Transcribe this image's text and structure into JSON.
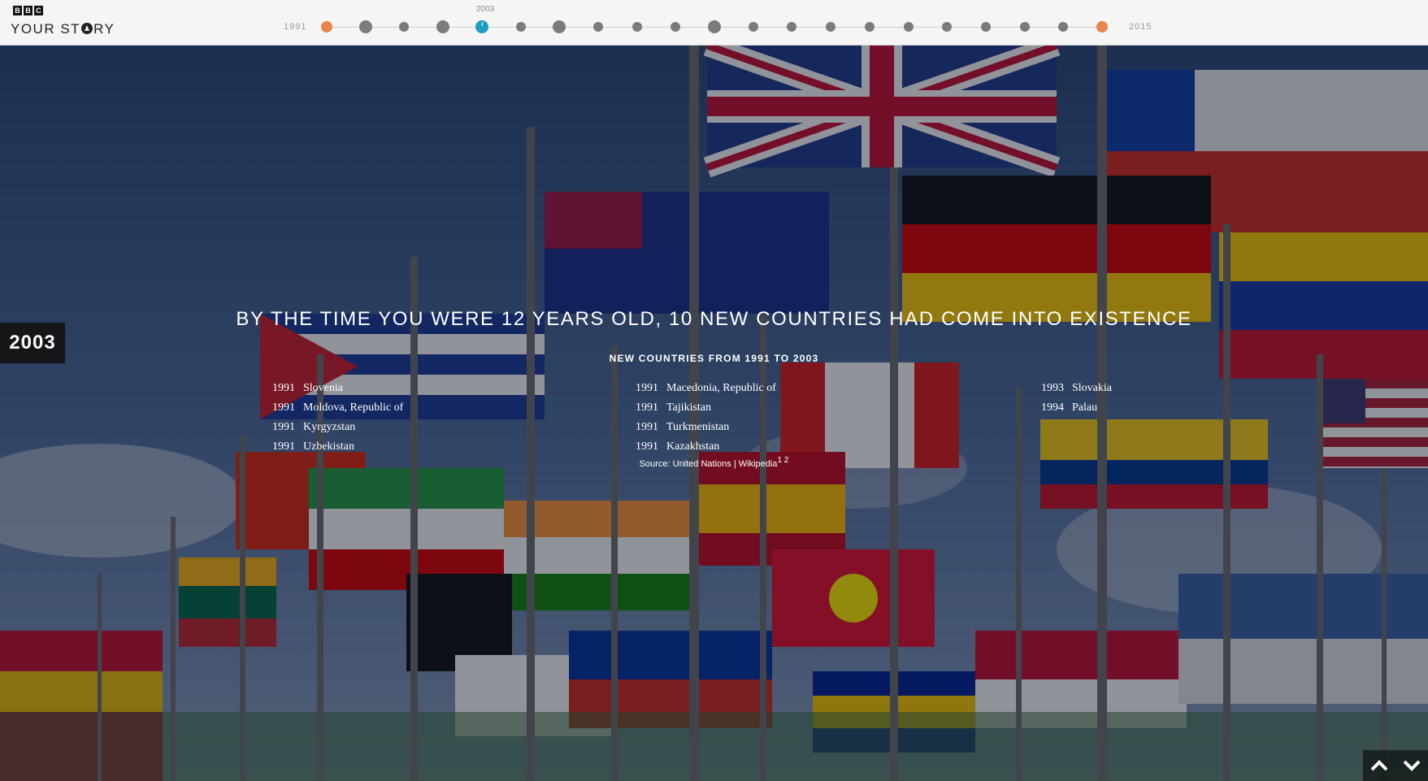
{
  "header": {
    "logo_letters": [
      "B",
      "B",
      "C"
    ],
    "brand_left": "YOUR ST",
    "brand_right": "RY"
  },
  "timeline": {
    "start_year": "1991",
    "end_year": "2015",
    "current_year_label": "2003",
    "colors": {
      "endpoint": "#e8854a",
      "current": "#1a9fc2",
      "default": "#7b7b7b",
      "line": "#cfcfcf"
    }
  },
  "main": {
    "year_badge": "2003",
    "headline": "BY THE TIME YOU WERE 12 YEARS OLD, 10 NEW COUNTRIES HAD COME INTO EXISTENCE",
    "subheading": "NEW COUNTRIES FROM 1991 TO 2003",
    "columns": [
      [
        {
          "year": "1991",
          "country": "Slovenia"
        },
        {
          "year": "1991",
          "country": "Moldova, Republic of"
        },
        {
          "year": "1991",
          "country": "Kyrgyzstan"
        },
        {
          "year": "1991",
          "country": "Uzbekistan"
        }
      ],
      [
        {
          "year": "1991",
          "country": "Macedonia, Republic of"
        },
        {
          "year": "1991",
          "country": "Tajikistan"
        },
        {
          "year": "1991",
          "country": "Turkmenistan"
        },
        {
          "year": "1991",
          "country": "Kazakhstan"
        }
      ],
      [
        {
          "year": "1993",
          "country": "Slovakia"
        },
        {
          "year": "1994",
          "country": "Palau"
        }
      ]
    ],
    "source_text": "Source: United Nations | Wikipedia",
    "source_refs": "1 2"
  },
  "nav": {
    "up_icon": "chevron-up-icon",
    "down_icon": "chevron-down-icon"
  }
}
